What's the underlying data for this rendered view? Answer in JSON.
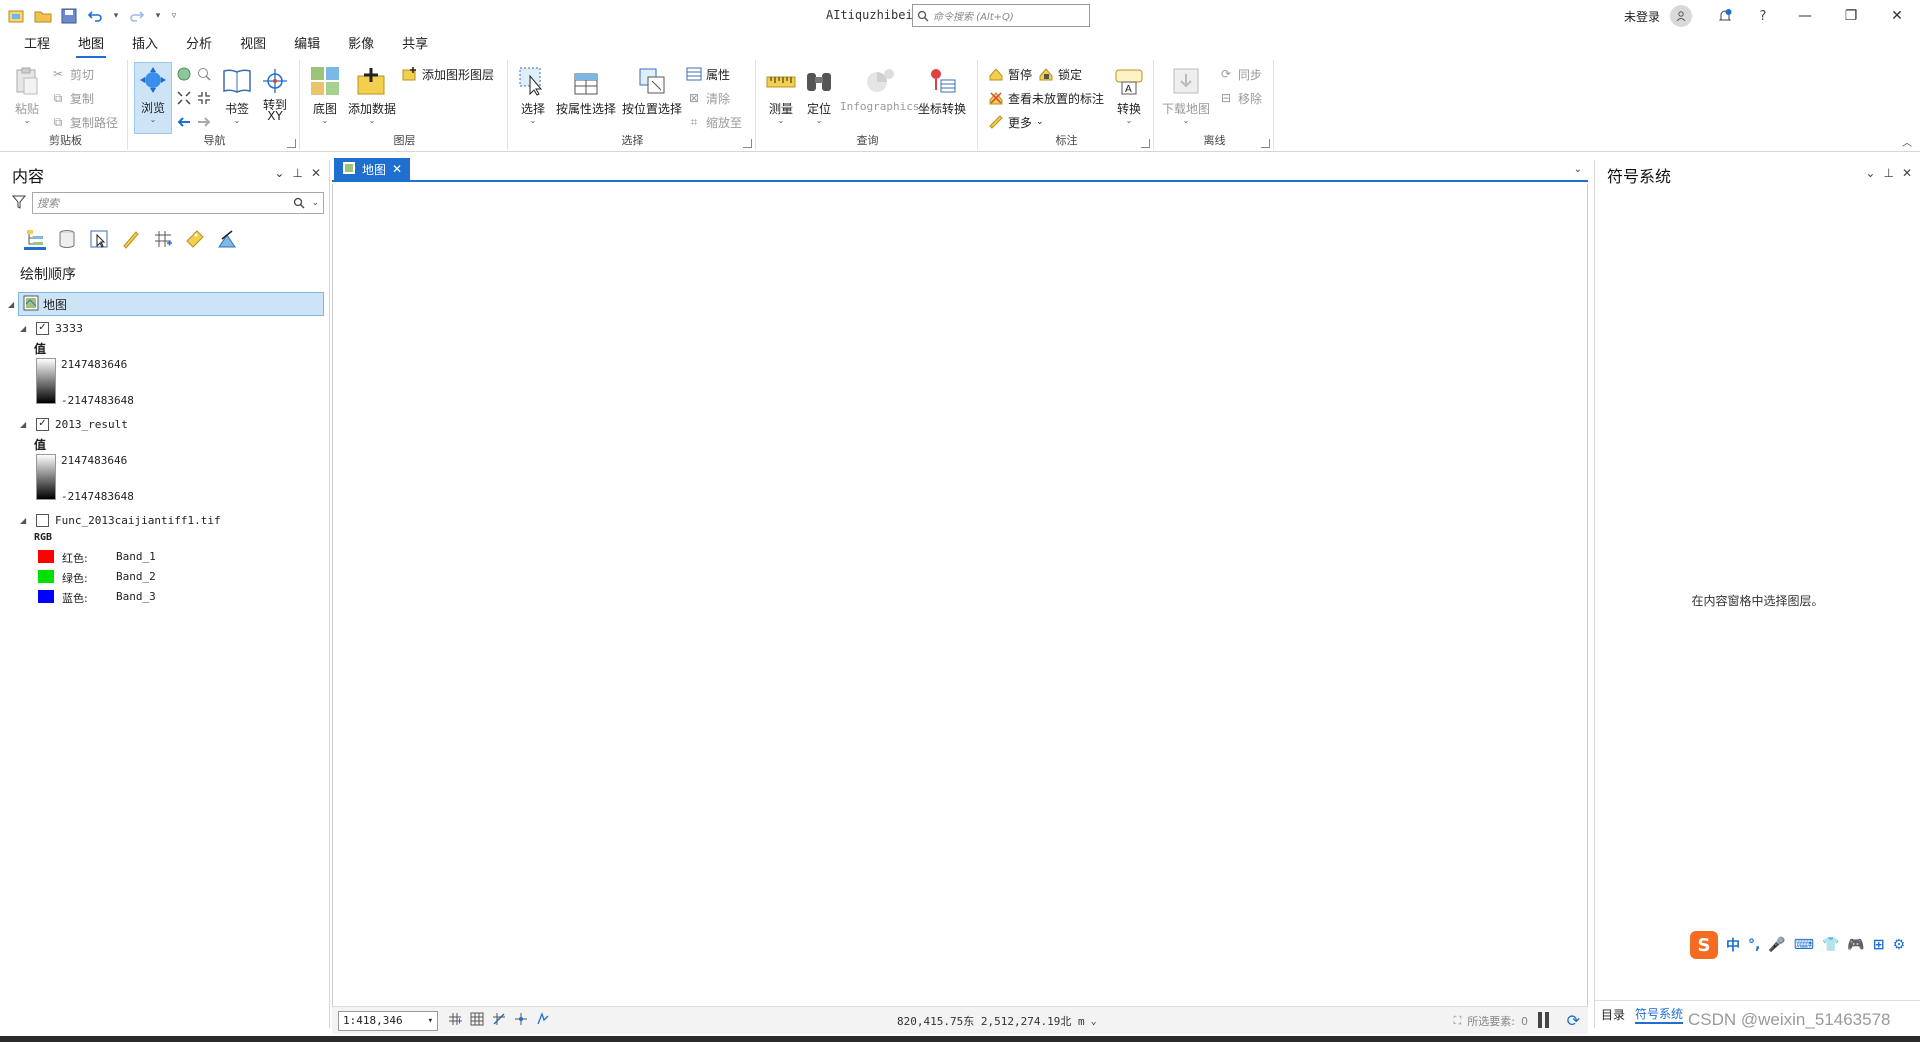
{
  "window": {
    "app_title": "AItiquzhibei",
    "command_search_placeholder": "命令搜索 (Alt+Q)",
    "login_label": "未登录",
    "help": "?"
  },
  "tabs": [
    {
      "label": "工程"
    },
    {
      "label": "地图"
    },
    {
      "label": "插入"
    },
    {
      "label": "分析"
    },
    {
      "label": "视图"
    },
    {
      "label": "编辑"
    },
    {
      "label": "影像"
    },
    {
      "label": "共享"
    }
  ],
  "active_tab": "地图",
  "ribbon": {
    "clipboard": {
      "label": "剪贴板",
      "paste": "粘贴",
      "cut": "剪切",
      "copy": "复制",
      "copy_path": "复制路径"
    },
    "navigate": {
      "label": "导航",
      "explore": "浏览",
      "bookmarks": "书签",
      "goto_xy": "转到\nXY"
    },
    "layer": {
      "label": "图层",
      "basemap": "底图",
      "add_data": "添加数据",
      "add_graphics_layer": "添加图形图层"
    },
    "selection": {
      "label": "选择",
      "select": "选择",
      "select_by_attributes": "按属性选择",
      "select_by_location": "按位置选择",
      "attributes": "属性",
      "clear": "清除",
      "zoom_to": "缩放至"
    },
    "inquiry": {
      "label": "查询",
      "measure": "测量",
      "locate": "定位",
      "infographics": "Infographics",
      "coordinate_conversion": "坐标转换"
    },
    "labeling": {
      "label": "标注",
      "pause": "暂停",
      "lock": "锁定",
      "view_unplaced": "查看未放置的标注",
      "more": "更多",
      "convert": "转换"
    },
    "offline": {
      "label": "离线",
      "download_map": "下载地图",
      "sync": "同步",
      "remove": "移除"
    }
  },
  "contents_panel": {
    "title": "内容",
    "search_placeholder": "搜索",
    "draw_order_label": "绘制顺序",
    "map_item": "地图",
    "layers": [
      {
        "name": "3333",
        "checked": true,
        "legend_title": "值",
        "high": "2147483646",
        "low": "-2147483648"
      },
      {
        "name": "2013_result",
        "checked": true,
        "legend_title": "值",
        "high": "2147483646",
        "low": "-2147483648"
      },
      {
        "name": "Func_2013caijiantiff1.tif",
        "checked": false,
        "legend_title": "RGB",
        "bands": [
          {
            "channel": "红色:",
            "band": "Band_1",
            "color": "#ff0000"
          },
          {
            "channel": "绿色:",
            "band": "Band_2",
            "color": "#00e000"
          },
          {
            "channel": "蓝色:",
            "band": "Band_3",
            "color": "#0000ff"
          }
        ]
      }
    ]
  },
  "map_view": {
    "tab_label": "地图",
    "scale": "1:418,346",
    "coordinates": "820,415.75东 2,512,274.19北 m",
    "selected_features_label": "所选要素:",
    "selected_features_count": "0"
  },
  "symbology_panel": {
    "title": "符号系统",
    "message": "在内容窗格中选择图层。",
    "bottom_tabs": [
      {
        "label": "目录"
      },
      {
        "label": "符号系统"
      }
    ]
  },
  "ime": {
    "logo": "S",
    "items": [
      "中",
      "°,",
      "🎤",
      "⌨",
      "👕",
      "🎮",
      "⊞",
      "⚙"
    ]
  },
  "watermark": "CSDN @weixin_51463578",
  "colors": {
    "accent": "#1f6fd1",
    "selection_bg": "#cde4f7"
  }
}
